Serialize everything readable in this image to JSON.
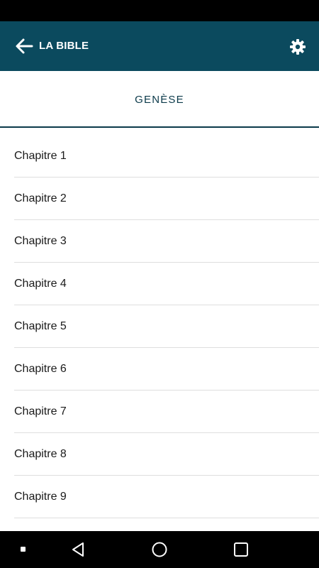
{
  "app_bar": {
    "title": "LA BIBLE",
    "back_icon": "arrow-left-icon",
    "settings_icon": "gear-icon",
    "background_color": "#0b4a5e"
  },
  "tab": {
    "label": "GENÈSE",
    "indicator_color": "#0b3a4a"
  },
  "chapters": [
    {
      "label": "Chapitre 1"
    },
    {
      "label": "Chapitre 2"
    },
    {
      "label": "Chapitre 3"
    },
    {
      "label": "Chapitre 4"
    },
    {
      "label": "Chapitre 5"
    },
    {
      "label": "Chapitre 6"
    },
    {
      "label": "Chapitre 7"
    },
    {
      "label": "Chapitre 8"
    },
    {
      "label": "Chapitre 9"
    }
  ],
  "system_nav": {
    "back_icon": "triangle-back-icon",
    "home_icon": "circle-home-icon",
    "recents_icon": "square-recents-icon"
  }
}
